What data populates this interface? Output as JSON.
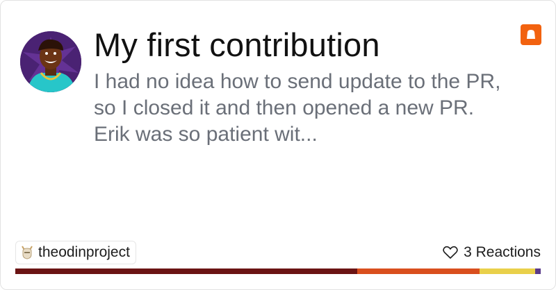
{
  "article": {
    "title": "My first contribution",
    "excerpt": "I had no idea how to send update to the PR, so I closed it and then opened a new PR. Erik was so patient wit..."
  },
  "avatar": {
    "icon": "user-avatar"
  },
  "platform": {
    "icon": "dev-platform-logo",
    "color": "#f2620f"
  },
  "organization": {
    "name": "theodinproject",
    "icon": "odin-helmet-logo"
  },
  "reactions": {
    "icon": "heart-icon",
    "label": "3 Reactions"
  },
  "colors": {
    "bar": [
      "#6b1414",
      "#d94f1e",
      "#e9d04a",
      "#5a3a8a"
    ]
  }
}
